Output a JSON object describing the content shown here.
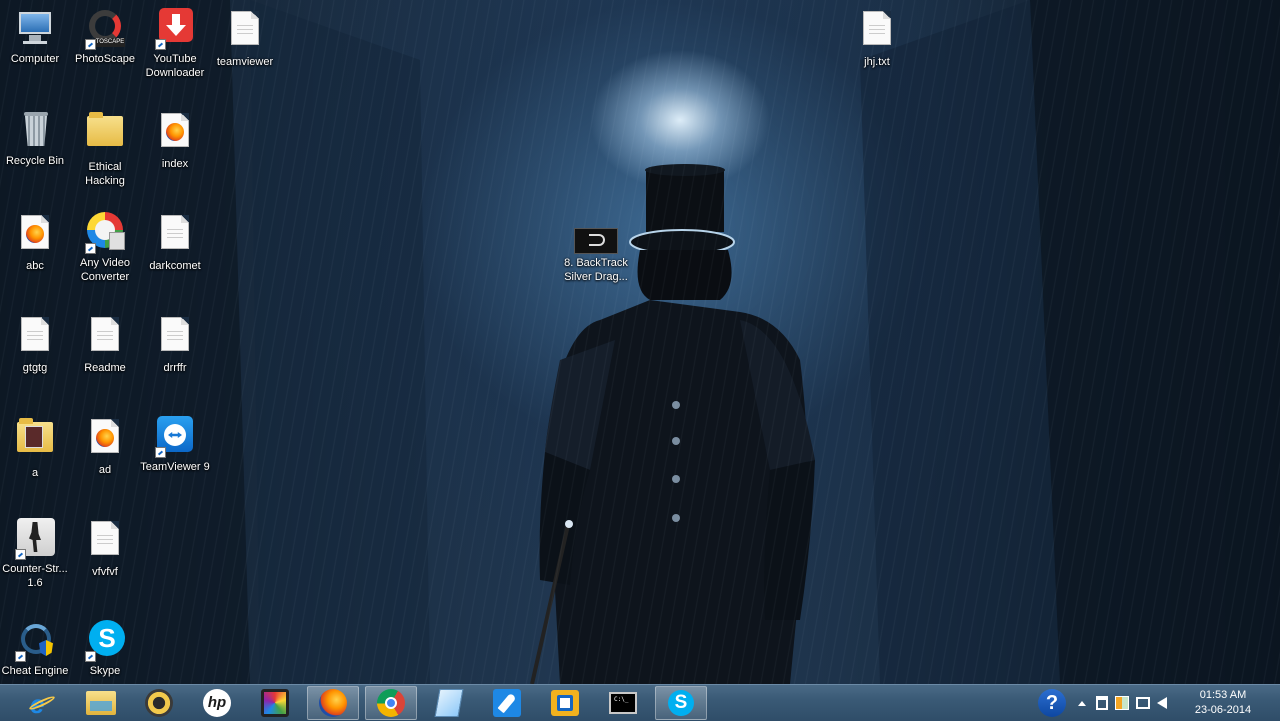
{
  "desktop": {
    "icons": [
      {
        "label": "Computer",
        "icon": "computer-icon"
      },
      {
        "label": "PhotoScape",
        "icon": "photoscape-icon"
      },
      {
        "label": "YouTube Downloader",
        "icon": "youtube-downloader-icon"
      },
      {
        "label": "teamviewer",
        "icon": "text-file-icon"
      },
      {
        "label": "jhj.txt",
        "icon": "text-file-icon"
      },
      {
        "label": "Recycle Bin",
        "icon": "recycle-bin-icon"
      },
      {
        "label": "Ethical Hacking",
        "icon": "folder-icon"
      },
      {
        "label": "index",
        "icon": "firefox-document-icon"
      },
      {
        "label": "abc",
        "icon": "firefox-document-icon"
      },
      {
        "label": "Any Video Converter",
        "icon": "any-video-converter-icon"
      },
      {
        "label": "darkcomet",
        "icon": "text-file-icon"
      },
      {
        "label": "8. BackTrack Silver Drag...",
        "icon": "backtrack-wallpaper-icon"
      },
      {
        "label": "gtgtg",
        "icon": "text-file-icon"
      },
      {
        "label": "Readme",
        "icon": "text-file-icon"
      },
      {
        "label": "drrffr",
        "icon": "text-file-icon"
      },
      {
        "label": "a",
        "icon": "folder-icon"
      },
      {
        "label": "ad",
        "icon": "firefox-document-icon"
      },
      {
        "label": "TeamViewer 9",
        "icon": "teamviewer-icon"
      },
      {
        "label": "Counter-Str... 1.6",
        "icon": "counter-strike-icon"
      },
      {
        "label": "vfvfvf",
        "icon": "text-file-icon"
      },
      {
        "label": "Cheat Engine",
        "icon": "cheat-engine-icon"
      },
      {
        "label": "Skype",
        "icon": "skype-icon"
      }
    ]
  },
  "taskbar": {
    "pinned": [
      {
        "name": "internet-explorer-icon",
        "active": false
      },
      {
        "name": "file-explorer-icon",
        "active": false
      },
      {
        "name": "media-player-icon",
        "active": false
      },
      {
        "name": "hp-icon",
        "active": false
      },
      {
        "name": "photoscape-icon",
        "active": false
      },
      {
        "name": "firefox-icon",
        "active": true
      },
      {
        "name": "chrome-icon",
        "active": true
      },
      {
        "name": "notepad-icon",
        "active": false
      },
      {
        "name": "rocket-app-icon",
        "active": false
      },
      {
        "name": "outlook-icon",
        "active": false
      },
      {
        "name": "command-prompt-icon",
        "active": false
      },
      {
        "name": "skype-icon",
        "active": true
      }
    ],
    "tray": {
      "icons": [
        "help-icon",
        "show-hidden-icons-chevron",
        "usb-device-icon",
        "action-center-flag-icon",
        "network-icon",
        "volume-icon"
      ]
    },
    "clock": {
      "time": "01:53 AM",
      "date": "23-06-2014"
    }
  },
  "colors": {
    "taskbar": "#3a5a76",
    "wallpaper_glow": "#a9cdea",
    "label_text": "#ffffff"
  }
}
